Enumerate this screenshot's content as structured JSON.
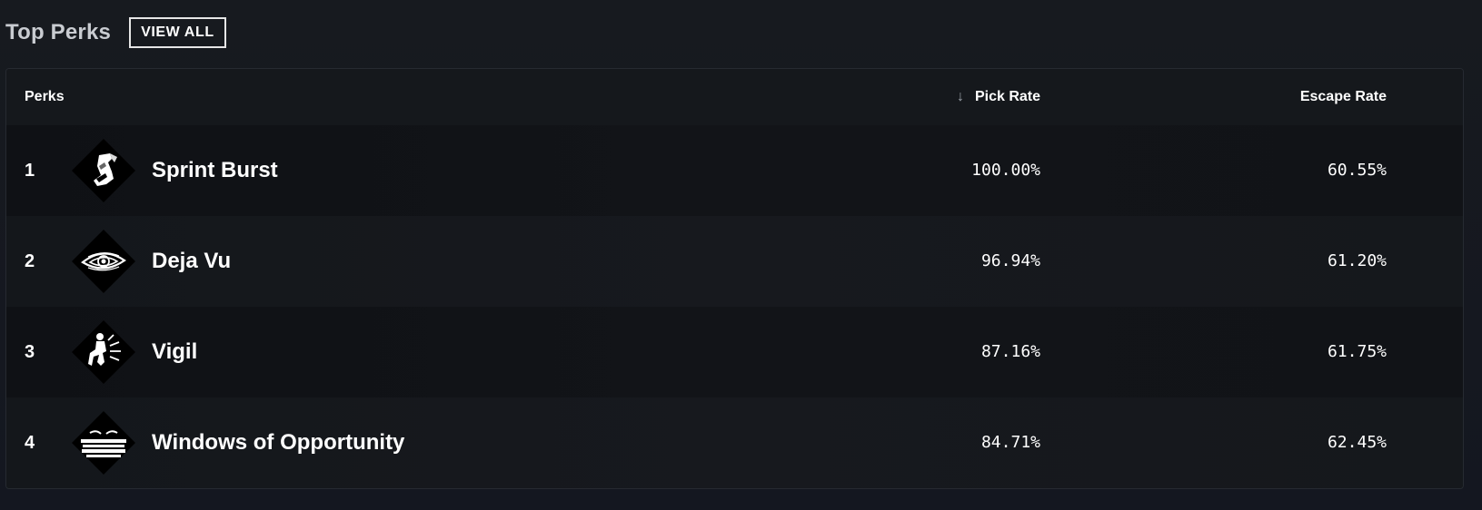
{
  "section": {
    "title": "Top Perks",
    "view_all_label": "VIEW ALL"
  },
  "table": {
    "columns": {
      "perks": "Perks",
      "pick_rate": "Pick Rate",
      "escape_rate": "Escape Rate"
    },
    "sort": {
      "column": "pick_rate",
      "direction": "descending",
      "icon": "arrow-down-icon"
    },
    "rows": [
      {
        "rank": "1",
        "name": "Sprint Burst",
        "icon": "sprint-burst-icon",
        "pick_rate": "100.00%",
        "escape_rate": "60.55%"
      },
      {
        "rank": "2",
        "name": "Deja Vu",
        "icon": "deja-vu-icon",
        "pick_rate": "96.94%",
        "escape_rate": "61.20%"
      },
      {
        "rank": "3",
        "name": "Vigil",
        "icon": "vigil-icon",
        "pick_rate": "87.16%",
        "escape_rate": "61.75%"
      },
      {
        "rank": "4",
        "name": "Windows of Opportunity",
        "icon": "windows-of-opportunity-icon",
        "pick_rate": "84.71%",
        "escape_rate": "62.45%"
      }
    ]
  },
  "colors": {
    "background": "#16191e",
    "row_dark": "#0f1115",
    "row_light": "#15181c",
    "text": "#ffffff",
    "title": "#c9ccd1",
    "perk_icon_bg": "#000000",
    "perk_icon_fg": "#ffffff"
  }
}
